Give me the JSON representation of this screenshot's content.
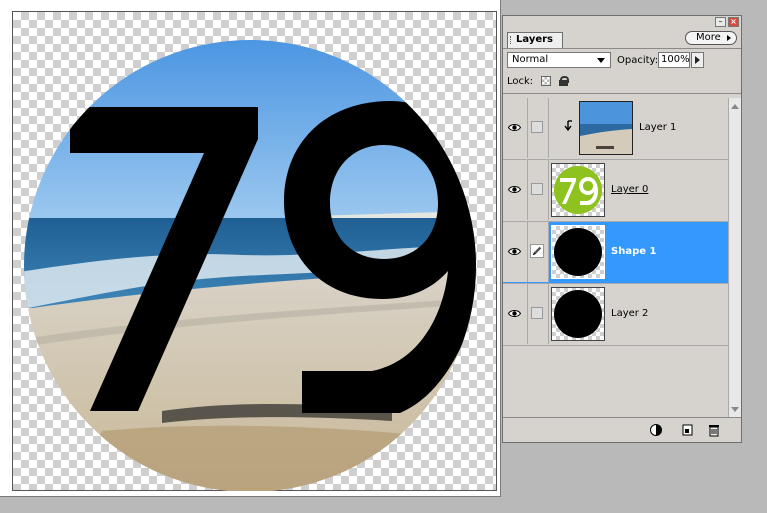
{
  "palette": {
    "tab_label": "Layers",
    "more_label": "More",
    "blend_mode": "Normal",
    "opacity_label": "Opacity:",
    "opacity_value": "100%",
    "lock_label": "Lock:",
    "layers": [
      {
        "name": "Layer 1",
        "thumb": "beach-photo",
        "visible": true,
        "clipped": true,
        "selected": false
      },
      {
        "name": "Layer 0",
        "thumb": "green-79-text",
        "visible": true,
        "selected": false
      },
      {
        "name": "Shape 1",
        "thumb": "black-circle",
        "visible": true,
        "selected": true
      },
      {
        "name": "Layer 2",
        "thumb": "black-circle",
        "visible": true,
        "selected": false
      }
    ]
  },
  "canvas": {
    "text": "79"
  },
  "colors": {
    "selection": "#3399ff",
    "text_fill": "#000000",
    "thumb_green": "#8ec21f"
  }
}
